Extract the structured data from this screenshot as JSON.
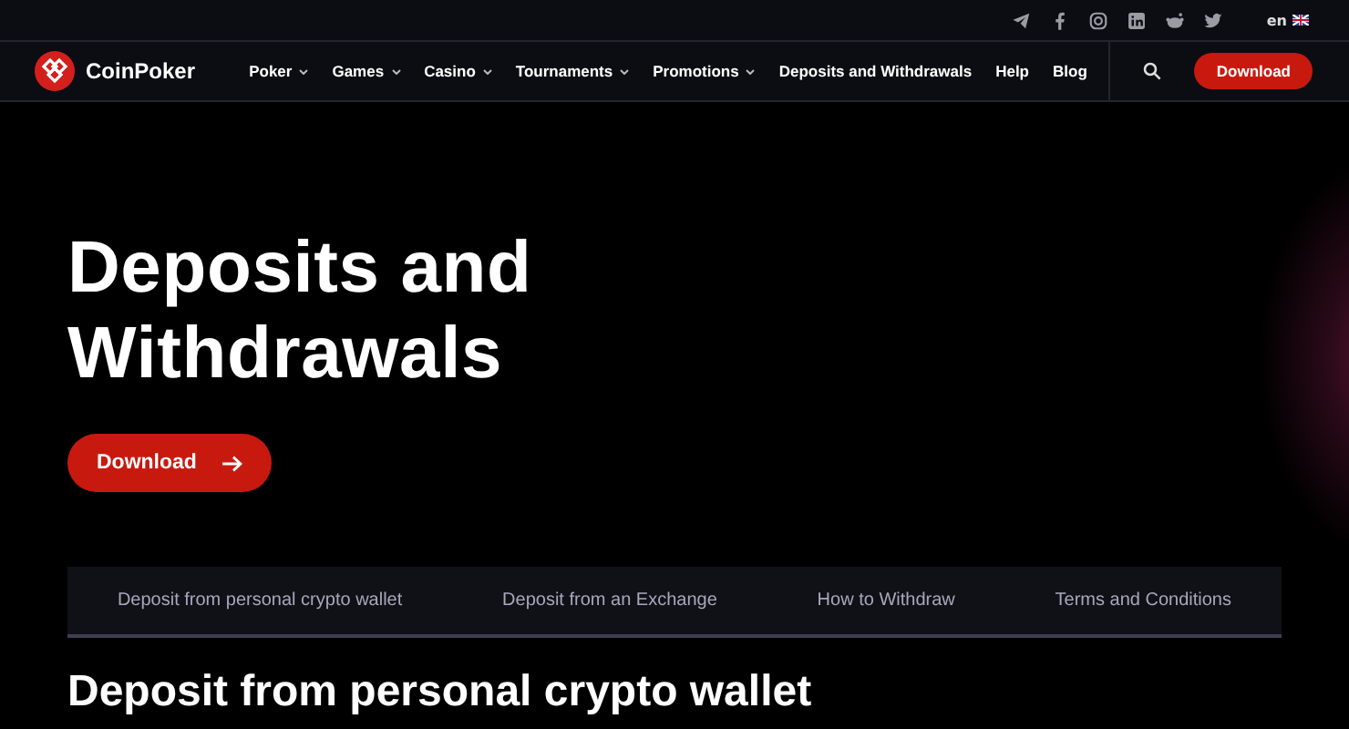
{
  "top_bar": {
    "social": [
      {
        "kind": "telegram"
      },
      {
        "kind": "facebook"
      },
      {
        "kind": "instagram"
      },
      {
        "kind": "linkedin"
      },
      {
        "kind": "reddit"
      },
      {
        "kind": "twitter"
      }
    ],
    "language": "en"
  },
  "header": {
    "logo": "CoinPoker",
    "nav": [
      {
        "label": "Poker",
        "dropdown": true
      },
      {
        "label": "Games",
        "dropdown": true
      },
      {
        "label": "Casino",
        "dropdown": true
      },
      {
        "label": "Tournaments",
        "dropdown": true
      },
      {
        "label": "Promotions",
        "dropdown": true
      },
      {
        "label": "Deposits and Withdrawals",
        "dropdown": false
      },
      {
        "label": "Help",
        "dropdown": false
      },
      {
        "label": "Blog",
        "dropdown": false
      }
    ],
    "download": "Download"
  },
  "hero": {
    "title": "Deposits and Withdrawals",
    "button": "Download"
  },
  "tabs": [
    {
      "label": "Deposit from personal crypto wallet"
    },
    {
      "label": "Deposit from an Exchange"
    },
    {
      "label": "How to Withdraw"
    },
    {
      "label": "Terms and Conditions"
    }
  ],
  "section_heading": "Deposit from personal crypto wallet"
}
